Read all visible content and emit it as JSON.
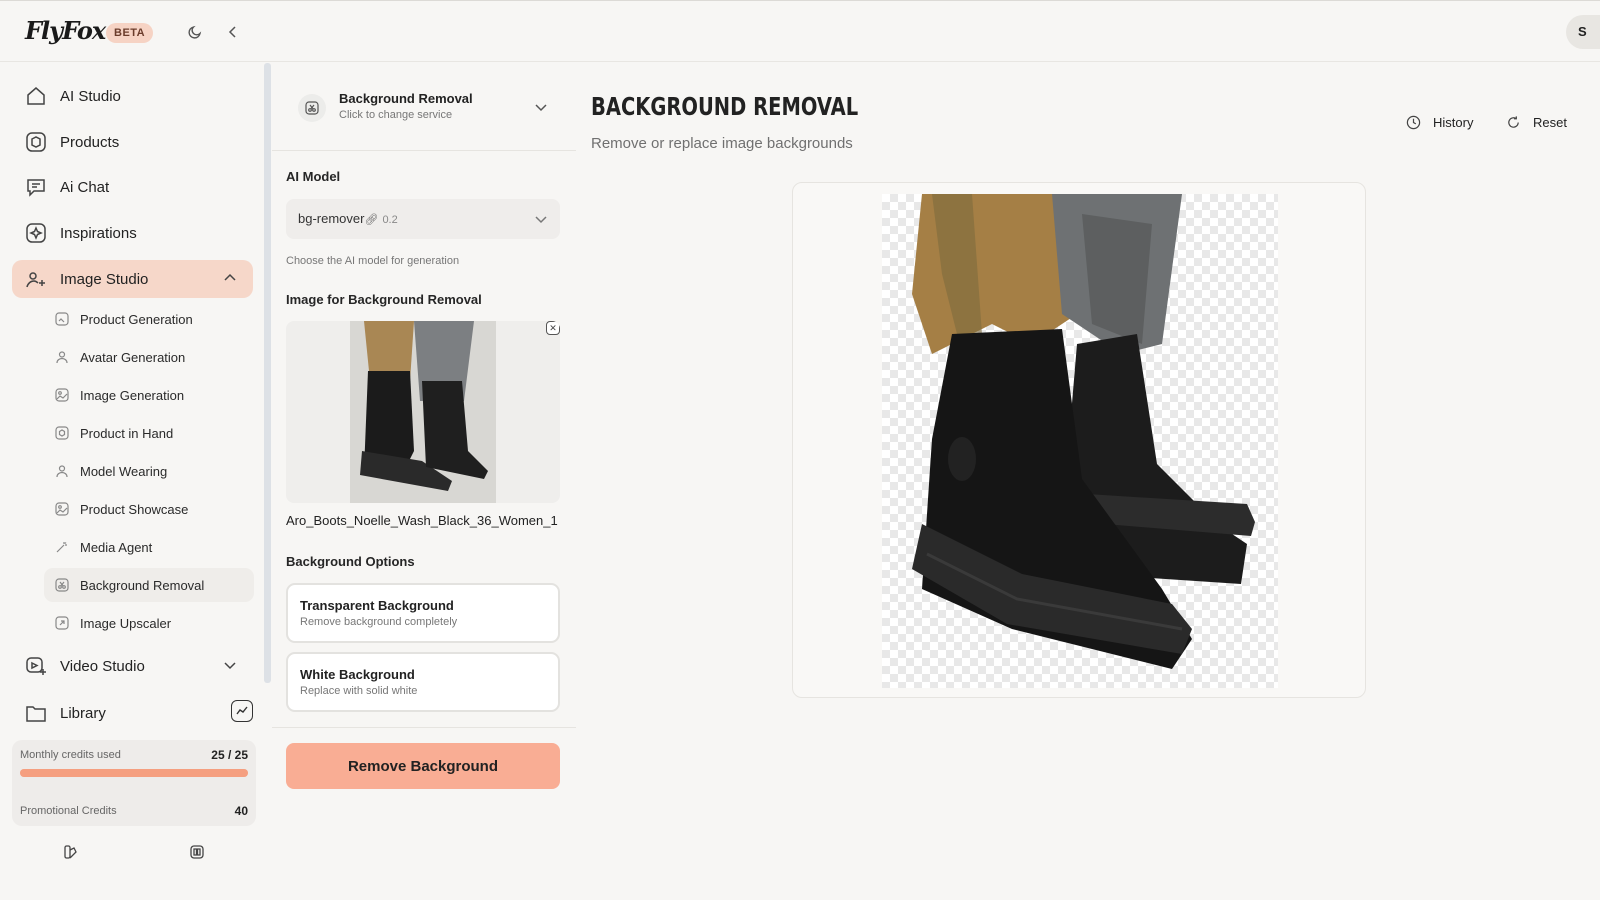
{
  "app": {
    "logo": "FlyFox",
    "badge": "BETA",
    "avatar_initial": "S"
  },
  "sidebar": {
    "items": [
      {
        "label": "AI Studio",
        "icon": "home-icon"
      },
      {
        "label": "Products",
        "icon": "box-icon"
      },
      {
        "label": "Ai Chat",
        "icon": "chat-icon"
      },
      {
        "label": "Inspirations",
        "icon": "sparkle-icon"
      },
      {
        "label": "Image Studio",
        "icon": "image-studio-icon"
      },
      {
        "label": "Video Studio",
        "icon": "video-icon"
      },
      {
        "label": "Library",
        "icon": "folder-icon"
      }
    ],
    "image_studio_items": [
      {
        "label": "Product Generation",
        "icon": "product-icon"
      },
      {
        "label": "Avatar Generation",
        "icon": "user-icon"
      },
      {
        "label": "Image Generation",
        "icon": "image-icon"
      },
      {
        "label": "Product in Hand",
        "icon": "product-icon"
      },
      {
        "label": "Model Wearing",
        "icon": "user-icon"
      },
      {
        "label": "Product Showcase",
        "icon": "image-icon"
      },
      {
        "label": "Media Agent",
        "icon": "wand-icon"
      },
      {
        "label": "Background Removal",
        "icon": "scissors-icon"
      },
      {
        "label": "Image Upscaler",
        "icon": "upscale-icon"
      }
    ],
    "credits": {
      "monthly_label": "Monthly credits used",
      "monthly_value": "25 / 25",
      "monthly_fraction": 1.0,
      "promo_label": "Promotional Credits",
      "promo_value": "40"
    }
  },
  "panel": {
    "service_title": "Background Removal",
    "service_sub": "Click to change service",
    "model_label": "AI Model",
    "model_value": "bg-remover",
    "model_version": "0.2",
    "model_hint": "Choose the AI model for generation",
    "image_label": "Image for Background Removal",
    "file_name": "Aro_Boots_Noelle_Wash_Black_36_Women_1",
    "options_label": "Background Options",
    "options": [
      {
        "title": "Transparent Background",
        "desc": "Remove background completely"
      },
      {
        "title": "White Background",
        "desc": "Replace with solid white"
      }
    ],
    "cta": "Remove Background"
  },
  "main": {
    "title": "BACKGROUND REMOVAL",
    "subtitle": "Remove or replace image backgrounds",
    "history": "History",
    "reset": "Reset"
  },
  "colors": {
    "accent": "#f9ad94",
    "active_nav": "#f6d7c9",
    "badge": "#f6d3c4"
  }
}
